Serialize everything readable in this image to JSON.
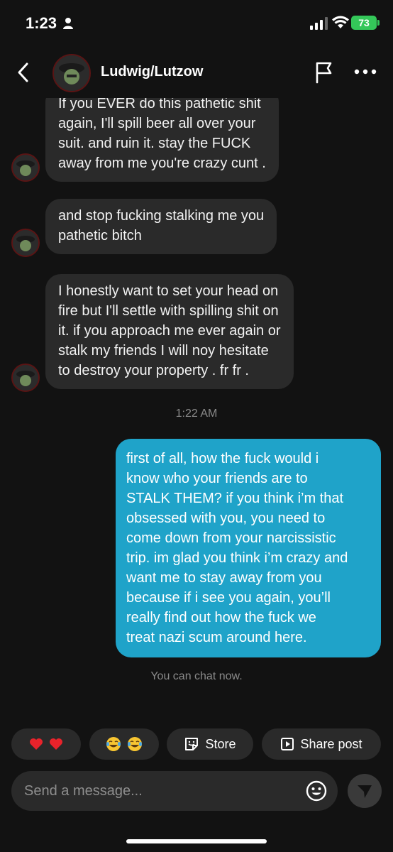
{
  "status_bar": {
    "time": "1:23",
    "battery": "73"
  },
  "header": {
    "name": "Ludwig/Lutzow",
    "icons": [
      "back-chevron-icon",
      "flag-icon",
      "more-dots-icon"
    ]
  },
  "messages": [
    {
      "from": "them",
      "lines": [
        "If you EVER do this pathetic shit",
        "again, I'll spill beer all over your",
        "suit. and ruin it. stay the FUCK",
        "away from me you're crazy cunt ."
      ]
    },
    {
      "from": "them",
      "lines": [
        "and stop fucking stalking me you",
        "pathetic bitch"
      ]
    },
    {
      "from": "them",
      "lines": [
        "I honestly want to set your head on",
        "fire but I'll settle with spilling shit on",
        "it. if you approach me ever again or",
        "stalk my friends I will noy hesitate",
        "to destroy your property . fr fr ."
      ]
    },
    {
      "from": "me",
      "lines": [
        "first of all, how the fuck would i",
        "know who your friends are to",
        "STALK THEM? if you think i’m that",
        "obsessed with you, you need to",
        "come down from your narcissistic",
        "trip. im glad you think i’m crazy and",
        "want me to stay away from you",
        "because if i see you again, you’ll",
        "really find out how the fuck we",
        "treat nazi scum around here."
      ]
    }
  ],
  "timestamp": "1:22 AM",
  "system_notice": "You can chat now.",
  "quick_actions": [
    {
      "label": "",
      "icon": "double-heart-emoji"
    },
    {
      "label": "",
      "icon": "double-laugh-emoji"
    },
    {
      "label": "Store",
      "icon": "store-sticker-icon"
    },
    {
      "label": "Share post",
      "icon": "share-post-icon"
    }
  ],
  "composer": {
    "placeholder": "Send a message...",
    "icons": [
      "smile-icon",
      "send-icon"
    ]
  },
  "colors": {
    "background": "#121212",
    "incoming_bubble": "#2a2a2a",
    "outgoing_bubble": "#1fa3c9",
    "battery": "#34c759"
  }
}
